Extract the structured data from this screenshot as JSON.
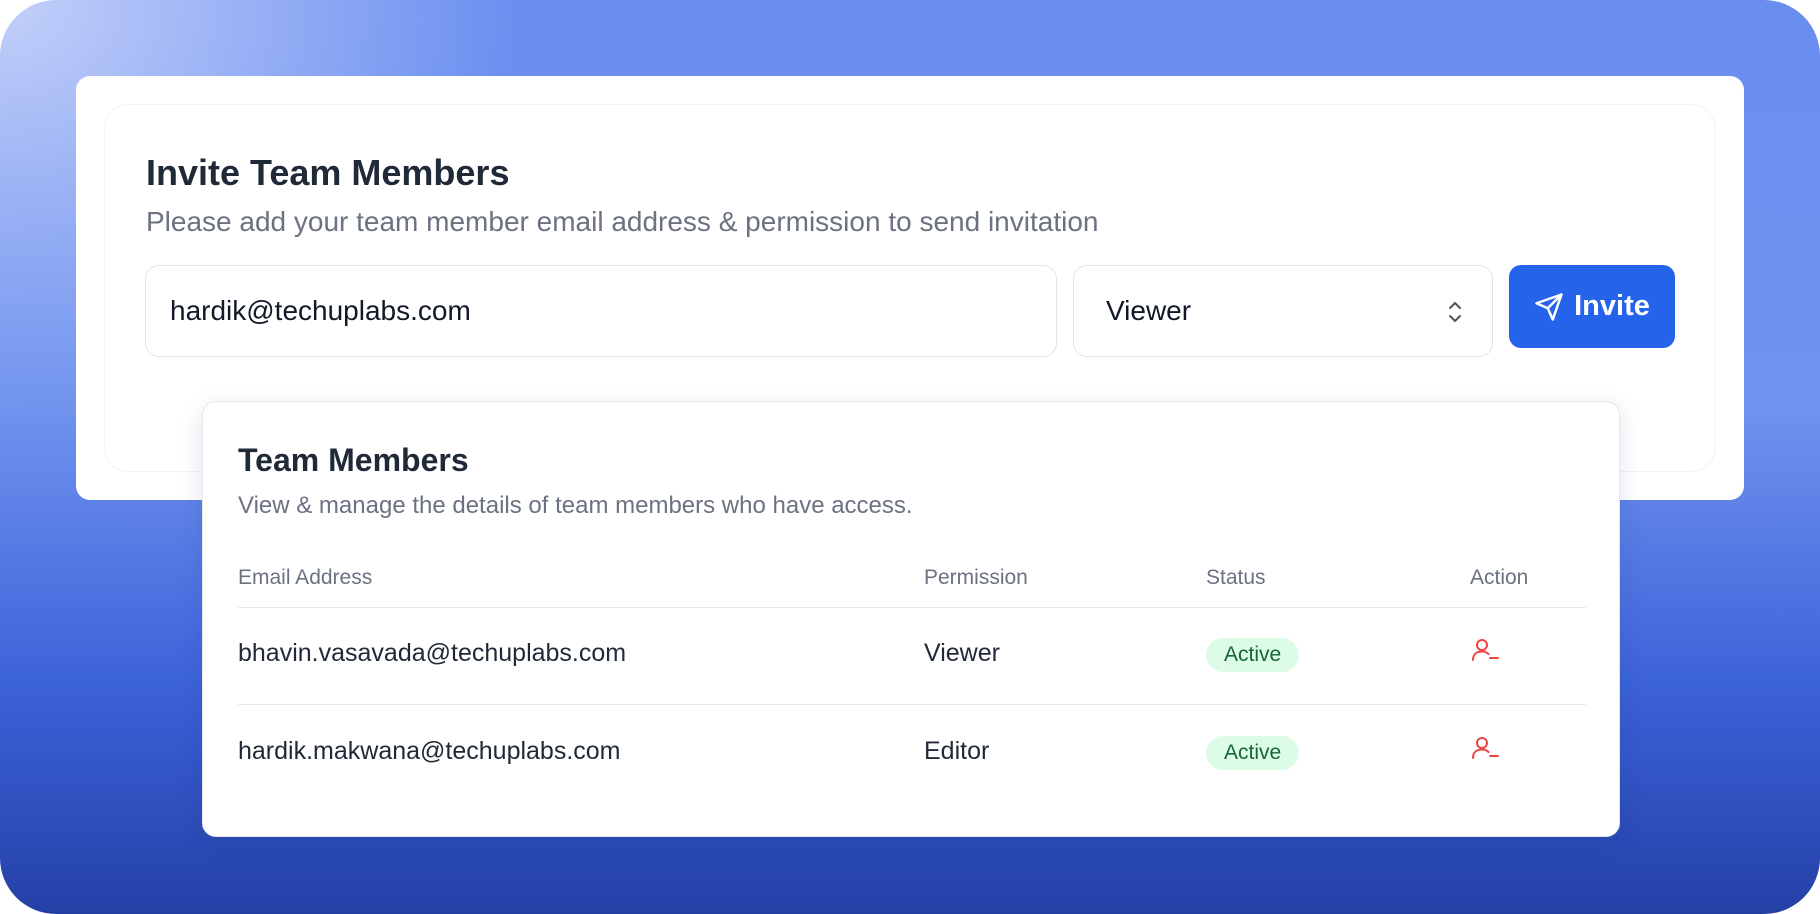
{
  "invite": {
    "title": "Invite Team Members",
    "subtitle": "Please add your team member email address & permission to send invitation",
    "email_value": "hardik@techuplabs.com",
    "permission_selected": "Viewer",
    "invite_label": "Invite"
  },
  "members": {
    "title": "Team Members",
    "subtitle": "View & manage the details of team members who have access.",
    "columns": [
      "Email Address",
      "Permission",
      "Status",
      "Action"
    ],
    "rows": [
      {
        "email": "bhavin.vasavada@techuplabs.com",
        "permission": "Viewer",
        "status": "Active",
        "action_icon": "user-remove-icon"
      },
      {
        "email": "hardik.makwana@techuplabs.com",
        "permission": "Editor",
        "status": "Active",
        "action_icon": "user-remove-icon"
      }
    ]
  },
  "colors": {
    "accent": "#2563eb",
    "status_active_bg": "#dcfce7",
    "status_active_text": "#166534",
    "danger": "#ef4444"
  }
}
